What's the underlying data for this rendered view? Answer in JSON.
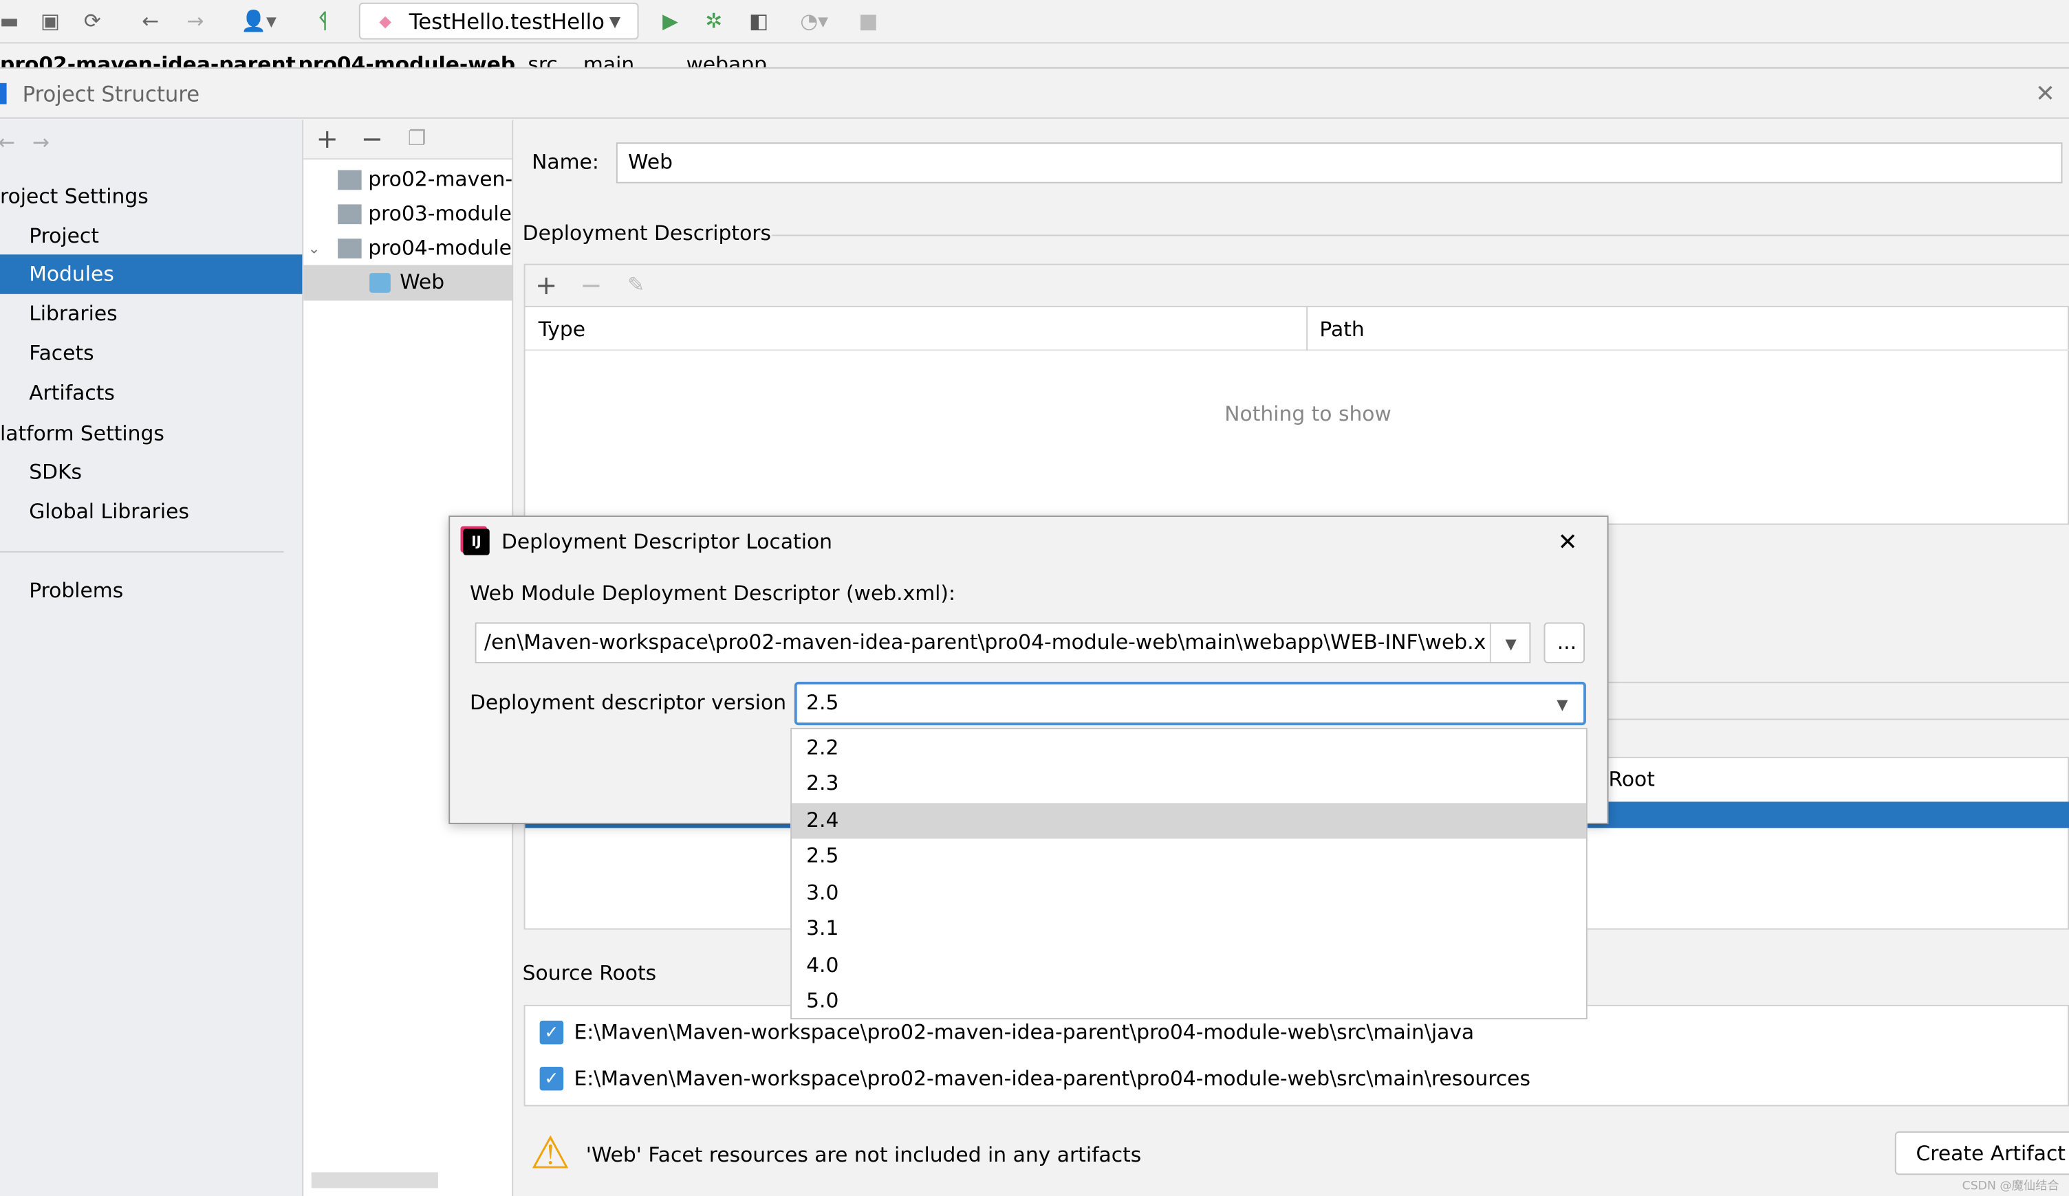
{
  "toolbar": {
    "run_config": "TestHello.testHello",
    "icons": [
      "open-icon",
      "save-icon",
      "sync-icon",
      "back-icon",
      "forward-icon",
      "user-icon",
      "build-hammer-icon",
      "run-icon",
      "debug-icon",
      "coverage-icon",
      "profile-icon",
      "stop-icon"
    ]
  },
  "breadcrumb": [
    "pro02-maven-idea-parent",
    "pro04-module-web",
    "src",
    "main",
    "webapp"
  ],
  "dialog": {
    "title": "Project Structure"
  },
  "sidebar": {
    "project_settings": "roject Settings",
    "items_top": [
      {
        "label": "Project"
      },
      {
        "label": "Modules",
        "selected": true
      },
      {
        "label": "Libraries"
      },
      {
        "label": "Facets"
      },
      {
        "label": "Artifacts"
      }
    ],
    "platform_settings": "latform Settings",
    "items_platform": [
      {
        "label": "SDKs"
      },
      {
        "label": "Global Libraries"
      }
    ],
    "problems": "Problems"
  },
  "tree": {
    "items": [
      {
        "label": "pro02-maven-"
      },
      {
        "label": "pro03-module"
      },
      {
        "label": "pro04-module"
      },
      {
        "label": "Web",
        "selected": true
      }
    ]
  },
  "facet": {
    "name_label": "Name:",
    "name_value": "Web",
    "descriptors_heading": "Deployment Descriptors",
    "col_type": "Type",
    "col_path": "Path",
    "empty_text": "Nothing to show",
    "root_header": "Root",
    "source_roots_heading": "Source Roots",
    "source_roots": [
      {
        "path": "E:\\Maven\\Maven-workspace\\pro02-maven-idea-parent\\pro04-module-web\\src\\main\\java",
        "checked": true
      },
      {
        "path": "E:\\Maven\\Maven-workspace\\pro02-maven-idea-parent\\pro04-module-web\\src\\main\\resources",
        "checked": true
      }
    ],
    "warning": "'Web' Facet resources are not included in any artifacts",
    "create_artifact": "Create Artifact"
  },
  "popup": {
    "title": "Deployment Descriptor Location",
    "descriptor_label": "Web Module Deployment Descriptor (web.xml):",
    "descriptor_path": "/en\\Maven-workspace\\pro02-maven-idea-parent\\pro04-module-web\\main\\webapp\\WEB-INF\\web.xml",
    "browse": "...",
    "version_label": "Deployment descriptor version",
    "version_value": "2.5",
    "options": [
      "2.2",
      "2.3",
      "2.4",
      "2.5",
      "3.0",
      "3.1",
      "4.0",
      "5.0"
    ],
    "highlighted_option": "2.4"
  },
  "watermark": "CSDN @魔仙结合",
  "colors": {
    "selection": "#2675bf",
    "accent_green": "#499c54",
    "focus": "#4a8fd6"
  }
}
